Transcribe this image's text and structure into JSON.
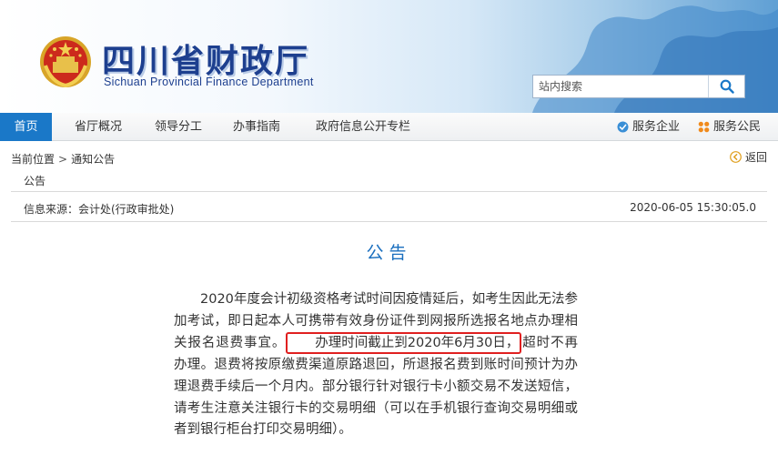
{
  "header": {
    "title": "四川省财政厅",
    "subtitle": "Sichuan Provincial Finance Department",
    "search_placeholder": "站内搜索",
    "emblem_icon": "national-emblem-icon",
    "search_icon": "search-icon"
  },
  "colors": {
    "nav_active": "#1a78c8",
    "title_blue": "#1d3f8f",
    "article_title": "#1a6fbf",
    "highlight_border": "#e02020"
  },
  "nav": {
    "items": [
      {
        "label": "首页",
        "active": true
      },
      {
        "label": "省厅概况"
      },
      {
        "label": "领导分工"
      },
      {
        "label": "办事指南"
      },
      {
        "label": "政府信息公开专栏"
      }
    ],
    "right": [
      {
        "label": "服务企业",
        "icon": "service-enterprise-icon"
      },
      {
        "label": "服务公民",
        "icon": "service-citizen-icon"
      }
    ]
  },
  "breadcrumb": {
    "prefix": "当前位置",
    "sep": ">",
    "current": "通知公告"
  },
  "back_label": "返回",
  "category": "公告",
  "meta": {
    "source": "信息来源：会计处(行政审批处)",
    "date": "2020-06-05 15:30:05.0"
  },
  "article": {
    "title": "公告",
    "body_before": "2020年度会计初级资格考试时间因疫情延后，如考生因此无法参加考试，即日起本人可携带有效身份证件到网报所选报名地点办理相关报名退费事宜。",
    "body_highlight": "办理时间截止到2020年6月30日，",
    "body_after": "超时不再办理。退费将按原缴费渠道原路退回，所退报名费到账时间预计为办理退费手续后一个月内。部分银行针对银行卡小额交易不发送短信，请考生注意关注银行卡的交易明细（可以在手机银行查询交易明细或者到银行柜台打印交易明细）。"
  }
}
